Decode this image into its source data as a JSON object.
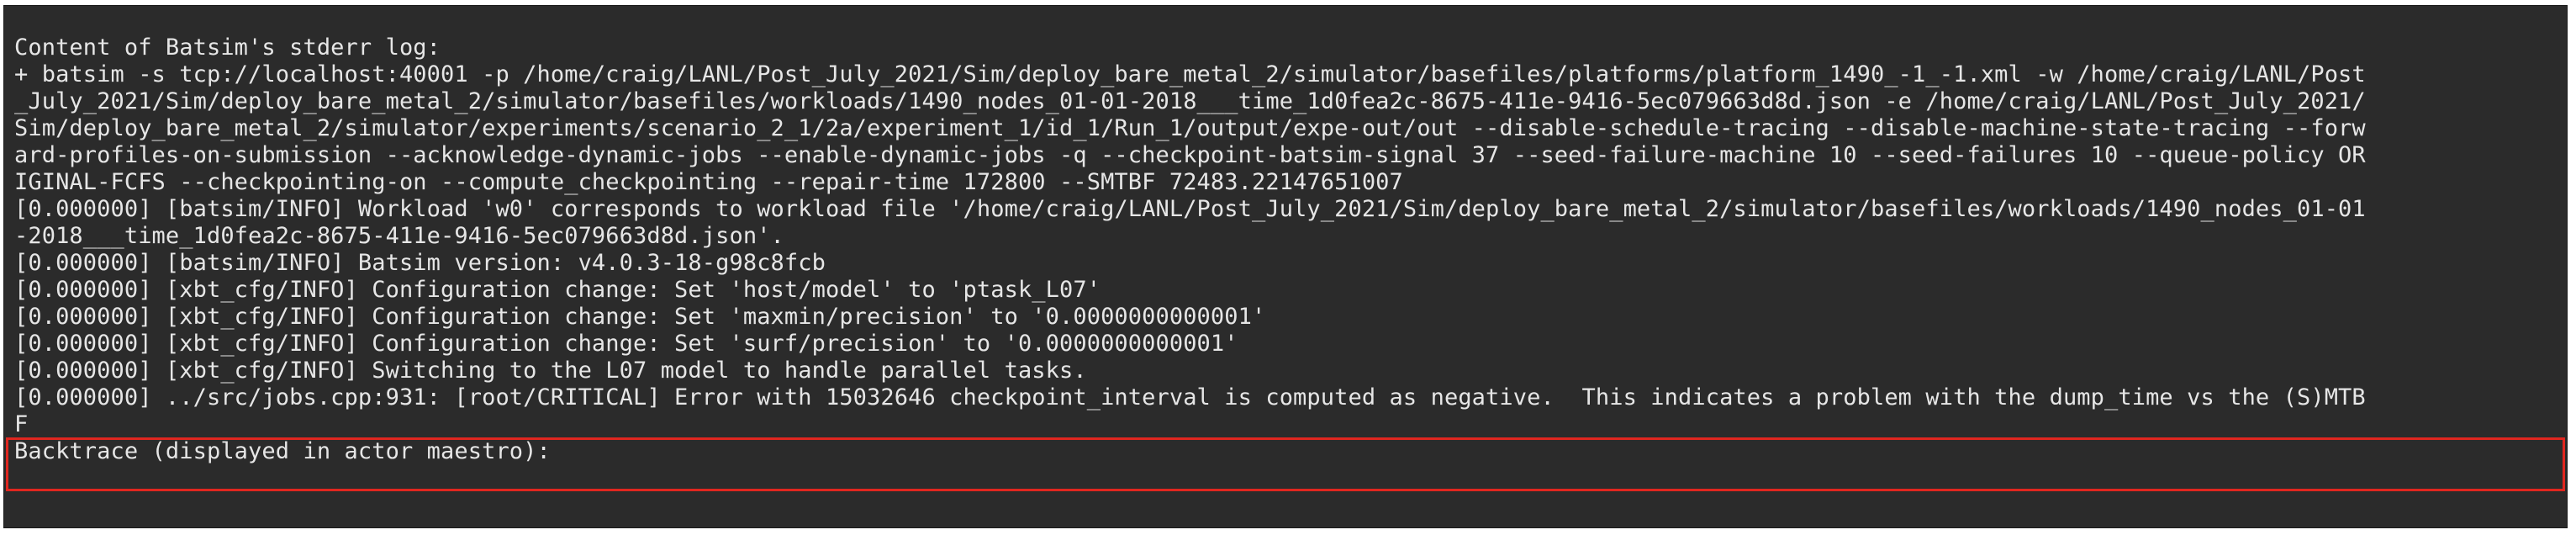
{
  "terminal": {
    "lines": [
      "Content of Batsim's stderr log:",
      "+ batsim -s tcp://localhost:40001 -p /home/craig/LANL/Post_July_2021/Sim/deploy_bare_metal_2/simulator/basefiles/platforms/platform_1490_-1_-1.xml -w /home/craig/LANL/Post",
      "_July_2021/Sim/deploy_bare_metal_2/simulator/basefiles/workloads/1490_nodes_01-01-2018___time_1d0fea2c-8675-411e-9416-5ec079663d8d.json -e /home/craig/LANL/Post_July_2021/",
      "Sim/deploy_bare_metal_2/simulator/experiments/scenario_2_1/2a/experiment_1/id_1/Run_1/output/expe-out/out --disable-schedule-tracing --disable-machine-state-tracing --forw",
      "ard-profiles-on-submission --acknowledge-dynamic-jobs --enable-dynamic-jobs -q --checkpoint-batsim-signal 37 --seed-failure-machine 10 --seed-failures 10 --queue-policy OR",
      "IGINAL-FCFS --checkpointing-on --compute_checkpointing --repair-time 172800 --SMTBF 72483.22147651007",
      "[0.000000] [batsim/INFO] Workload 'w0' corresponds to workload file '/home/craig/LANL/Post_July_2021/Sim/deploy_bare_metal_2/simulator/basefiles/workloads/1490_nodes_01-01",
      "-2018___time_1d0fea2c-8675-411e-9416-5ec079663d8d.json'.",
      "[0.000000] [batsim/INFO] Batsim version: v4.0.3-18-g98c8fcb",
      "[0.000000] [xbt_cfg/INFO] Configuration change: Set 'host/model' to 'ptask_L07'",
      "[0.000000] [xbt_cfg/INFO] Configuration change: Set 'maxmin/precision' to '0.0000000000001'",
      "[0.000000] [xbt_cfg/INFO] Configuration change: Set 'surf/precision' to '0.0000000000001'",
      "[0.000000] [xbt_cfg/INFO] Switching to the L07 model to handle parallel tasks.",
      "[0.000000] ../src/jobs.cpp:931: [root/CRITICAL] Error with 15032646 checkpoint_interval is computed as negative.  This indicates a problem with the dump_time vs the (S)MTB",
      "F",
      "Backtrace (displayed in actor maestro):"
    ]
  },
  "highlight": {
    "color": "#e0261f"
  }
}
